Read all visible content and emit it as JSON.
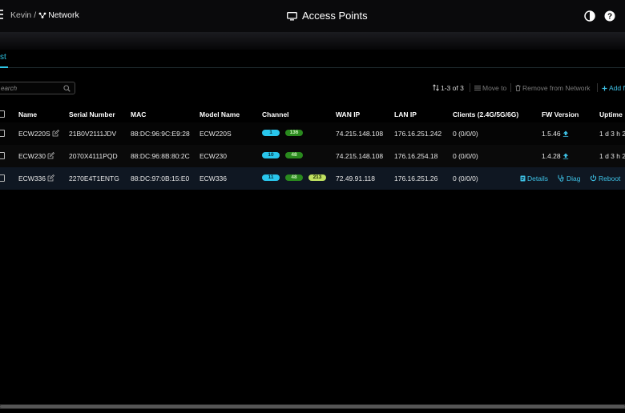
{
  "header": {
    "breadcrumb_site": "Kevin",
    "breadcrumb_sep": "/",
    "breadcrumb_network": "Network",
    "title": "Access Points",
    "theme_icon": "contrast-icon",
    "help_icon": "help-icon"
  },
  "tabs": [
    {
      "label": "st",
      "active": true
    }
  ],
  "search": {
    "placeholder": "earch"
  },
  "toolbar": {
    "count_label": "1-3 of 3",
    "move_label": "Move to",
    "remove_label": "Remove from Network",
    "add_label": "Add f"
  },
  "table": {
    "columns": [
      "Name",
      "Serial Number",
      "MAC",
      "Model Name",
      "Channel",
      "WAN IP",
      "LAN IP",
      "Clients (2.4G/5G/6G)",
      "FW Version",
      "Uptime"
    ],
    "rows": [
      {
        "name": "ECW220S",
        "serial": "21B0V2111JDV",
        "mac": "88:DC:96:9C:E9:28",
        "model": "ECW220S",
        "ch24": "1",
        "ch5": "136",
        "ch6": "",
        "wan": "74.215.148.108",
        "lan": "176.16.251.242",
        "clients": "0 (0/0/0)",
        "fw": "1.5.46",
        "uptime": "1 d 3 h 2"
      },
      {
        "name": "ECW230",
        "serial": "2070X4111PQD",
        "mac": "88:DC:96:8B:80:2C",
        "model": "ECW230",
        "ch24": "10",
        "ch5": "48",
        "ch6": "",
        "wan": "74.215.148.108",
        "lan": "176.16.254.18",
        "clients": "0 (0/0/0)",
        "fw": "1.4.28",
        "uptime": "1 d 3 h 2"
      },
      {
        "name": "ECW336",
        "serial": "2270E4T1ENTG",
        "mac": "88:DC:97:0B:15:E0",
        "model": "ECW336",
        "ch24": "11",
        "ch5": "48",
        "ch6": "213",
        "wan": "72.49.91.118",
        "lan": "176.16.251.26",
        "clients": "0 (0/0/0)"
      }
    ]
  },
  "row_actions": {
    "details": "Details",
    "diag": "Diag",
    "reboot": "Reboot"
  },
  "colors": {
    "accent": "#2ec7e6",
    "band24": "#29c6ec",
    "band5": "#2a8a1e",
    "band6": "#bfe060",
    "row_hover": "#0f1722"
  }
}
